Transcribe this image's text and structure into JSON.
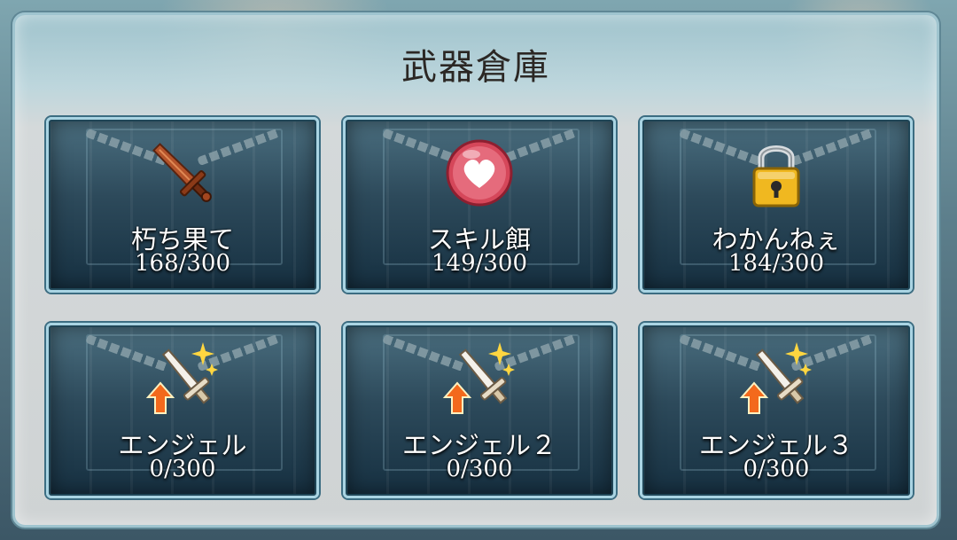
{
  "window": {
    "title": "武器倉庫"
  },
  "storage": {
    "slots": [
      {
        "name": "朽ち果て",
        "count": "168/300",
        "icon": "rusty-sword-icon"
      },
      {
        "name": "スキル餌",
        "count": "149/300",
        "icon": "heart-icon"
      },
      {
        "name": "わかんねぇ",
        "count": "184/300",
        "icon": "padlock-icon"
      },
      {
        "name": "エンジェル",
        "count": "0/300",
        "icon": "angel-sword-upgrade-icon"
      },
      {
        "name": "エンジェル２",
        "count": "0/300",
        "icon": "angel-sword-upgrade-icon"
      },
      {
        "name": "エンジェル３",
        "count": "0/300",
        "icon": "angel-sword-upgrade-icon"
      }
    ]
  },
  "colors": {
    "panel_border": "#9fc4cf",
    "card_border": "#a9d4e3",
    "card_bg": "#2d4a5b",
    "title_text": "#2b2724"
  }
}
